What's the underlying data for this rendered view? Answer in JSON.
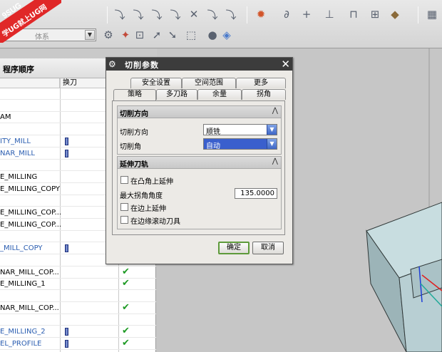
{
  "watermark": {
    "line1": "9SUG",
    "line2": "学UG就上UG网"
  },
  "toolbar": {
    "combo_value": "体系"
  },
  "navigator": {
    "title": "程序顺序",
    "col_tool": "换刀",
    "rows": [
      {
        "name": "",
        "tool": false,
        "check": false
      },
      {
        "name": "",
        "tool": false,
        "check": false
      },
      {
        "name": "AM",
        "tool": false,
        "check": false
      },
      {
        "name": "",
        "tool": false,
        "check": false
      },
      {
        "name": "ITY_MILL",
        "tool": true,
        "check": false
      },
      {
        "name": "NAR_MILL",
        "tool": true,
        "check": false
      },
      {
        "name": "",
        "tool": false,
        "check": false
      },
      {
        "name": "E_MILLING",
        "tool": false,
        "check": false
      },
      {
        "name": "E_MILLING_COPY",
        "tool": false,
        "check": false
      },
      {
        "name": "",
        "tool": false,
        "check": false
      },
      {
        "name": "E_MILLING_COP...",
        "tool": false,
        "check": false
      },
      {
        "name": "E_MILLING_COP...",
        "tool": false,
        "check": false
      },
      {
        "name": "",
        "tool": false,
        "check": false
      },
      {
        "name": "_MILL_COPY",
        "tool": true,
        "check": false
      },
      {
        "name": "",
        "tool": false,
        "check": false
      },
      {
        "name": "NAR_MILL_COP...",
        "tool": false,
        "check": true
      },
      {
        "name": "E_MILLING_1",
        "tool": false,
        "check": true
      },
      {
        "name": "",
        "tool": false,
        "check": false
      },
      {
        "name": "NAR_MILL_COP...",
        "tool": false,
        "check": true
      },
      {
        "name": "",
        "tool": false,
        "check": false
      },
      {
        "name": "E_MILLING_2",
        "tool": true,
        "check": true
      },
      {
        "name": "EL_PROFILE",
        "tool": true,
        "check": true
      }
    ]
  },
  "dialog": {
    "title": "切削参数",
    "tabs_row1": [
      "安全设置",
      "空间范围",
      "更多"
    ],
    "tabs_row2": [
      "策略",
      "多刀路",
      "余量",
      "拐角"
    ],
    "active_tab": "策略",
    "group_cut": {
      "title": "切削方向",
      "direction_label": "切削方向",
      "direction_value": "顺铣",
      "angle_label": "切削角",
      "angle_value": "自动"
    },
    "group_extend": {
      "title": "延伸刀轨",
      "convex_label": "在凸角上延伸",
      "max_corner_label": "最大拐角角度",
      "max_corner_value": "135.0000",
      "edge_label": "在边上延伸",
      "roll_label": "在边缘滚动刀具"
    },
    "ok_label": "确定",
    "cancel_label": "取消"
  },
  "colors": {
    "check": "#1e9a24",
    "link": "#2a5db0",
    "select_highlight": "#3a5fcd"
  }
}
